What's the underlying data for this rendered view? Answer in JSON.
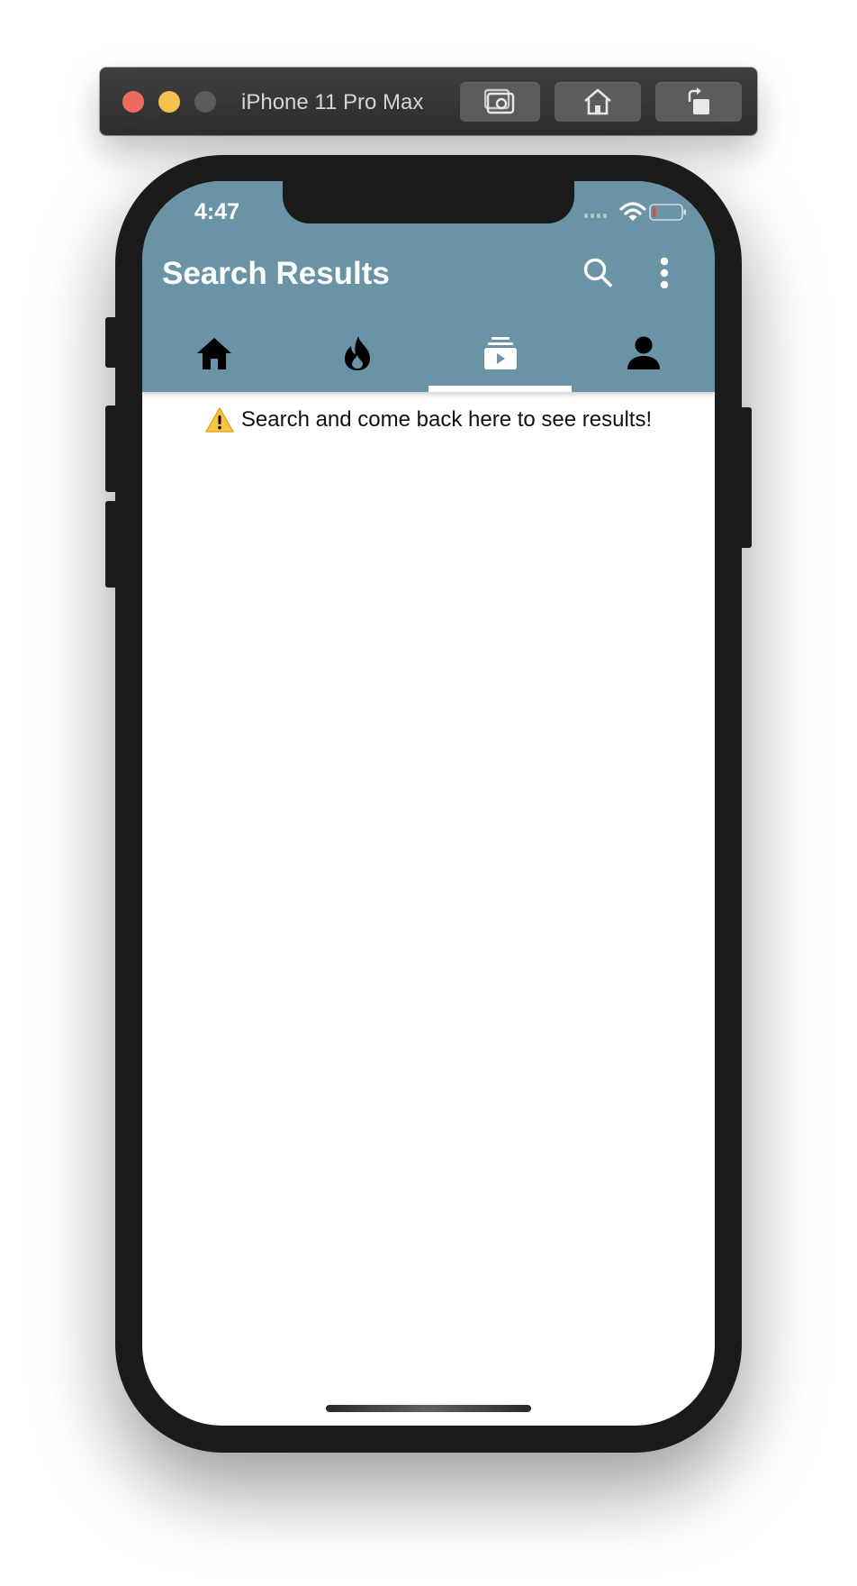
{
  "simulator": {
    "device_title": "iPhone 11 Pro Max",
    "buttons": [
      {
        "icon": "screenshot-icon"
      },
      {
        "icon": "home-icon"
      },
      {
        "icon": "rotate-icon"
      }
    ]
  },
  "status_bar": {
    "time": "4:47",
    "battery_color": "#e5483a"
  },
  "app_bar": {
    "title": "Search Results",
    "background": "#6a94a6",
    "actions": [
      {
        "icon": "search-icon"
      },
      {
        "icon": "more-vertical-icon"
      }
    ]
  },
  "tabs": [
    {
      "icon": "home-icon",
      "selected": false
    },
    {
      "icon": "trending-flame-icon",
      "selected": false
    },
    {
      "icon": "subscriptions-icon",
      "selected": true
    },
    {
      "icon": "person-icon",
      "selected": false
    }
  ],
  "content": {
    "message_icon": "warning-icon",
    "message": "Search and come back here to see results!"
  }
}
